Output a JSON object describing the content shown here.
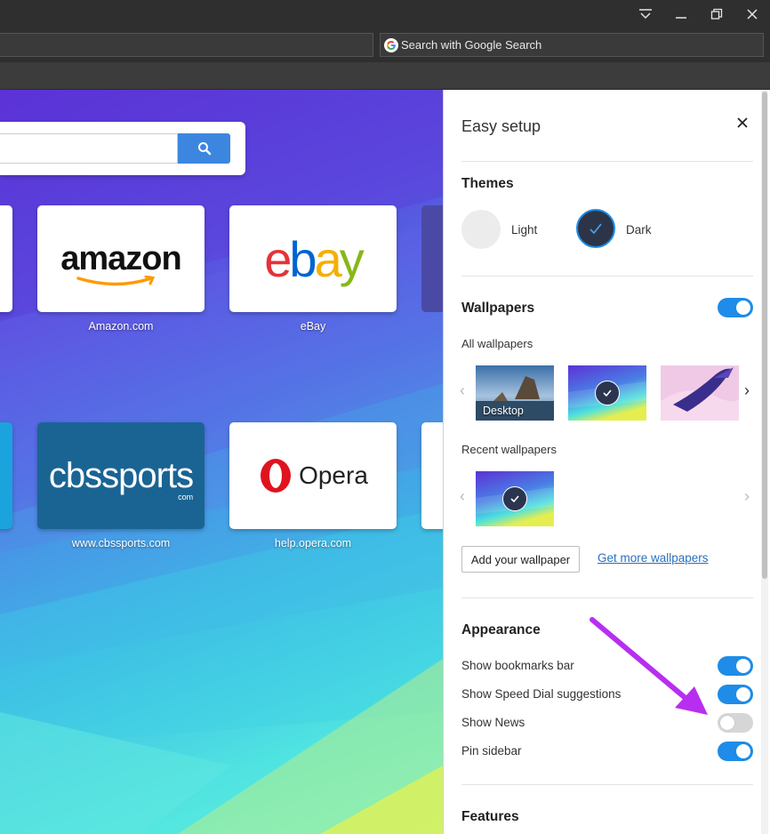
{
  "browser": {
    "search_placeholder": "Search with Google Search"
  },
  "speed_dial": {
    "tiles": [
      {
        "label": "Amazon.com",
        "logo": "amazon"
      },
      {
        "label": "eBay",
        "logo": "ebay"
      },
      {
        "label": "www.cbssports.com",
        "logo": "cbssports"
      },
      {
        "label": "help.opera.com",
        "logo": "Opera"
      }
    ],
    "cbs_sub": "com"
  },
  "easy_setup": {
    "title": "Easy setup",
    "themes": {
      "heading": "Themes",
      "light_label": "Light",
      "dark_label": "Dark",
      "selected": "Dark"
    },
    "wallpapers": {
      "heading": "Wallpapers",
      "enabled": true,
      "all_label": "All wallpapers",
      "desktop_label": "Desktop",
      "recent_label": "Recent wallpapers",
      "add_button": "Add your wallpaper",
      "more_link": "Get more wallpapers"
    },
    "appearance": {
      "heading": "Appearance",
      "items": [
        {
          "label": "Show bookmarks bar",
          "on": true
        },
        {
          "label": "Show Speed Dial suggestions",
          "on": true
        },
        {
          "label": "Show News",
          "on": false
        },
        {
          "label": "Pin sidebar",
          "on": true
        }
      ]
    },
    "features": {
      "heading": "Features"
    }
  },
  "colors": {
    "accent": "#1e8ce8",
    "annotation_arrow": "#b82ef0"
  }
}
